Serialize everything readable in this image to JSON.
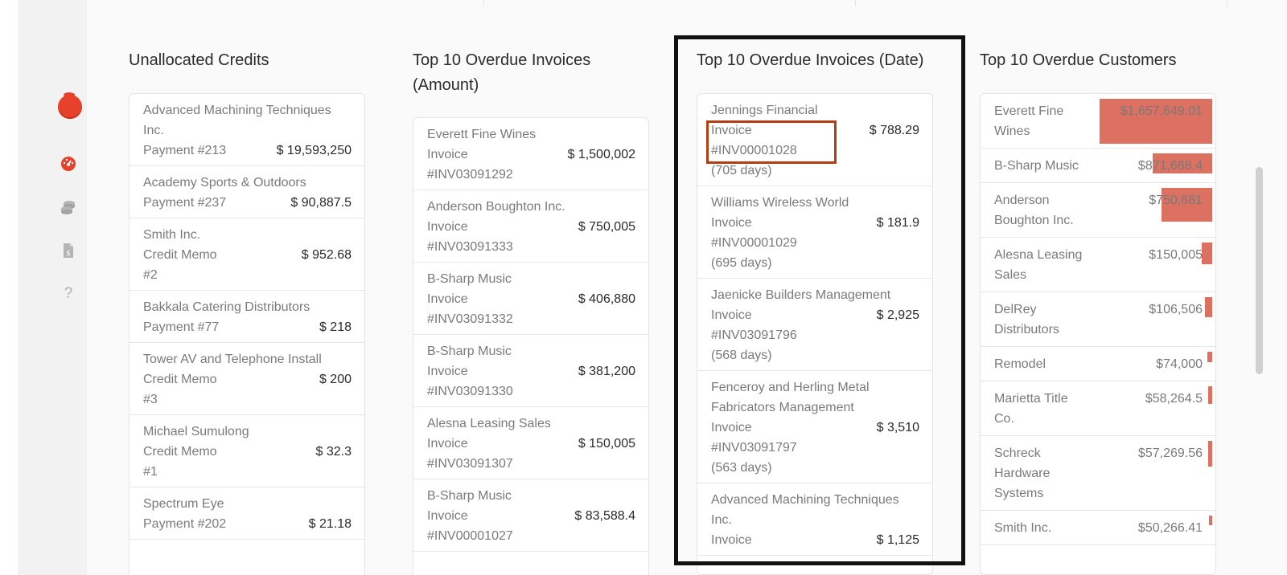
{
  "sidebar": {
    "icons": [
      "app-logo",
      "dashboard-icon",
      "coins-icon",
      "invoice-document-icon",
      "help-question-icon"
    ],
    "help_glyph": "?"
  },
  "columns": {
    "credits": {
      "title": "Unallocated Credits",
      "items": [
        {
          "name": "Advanced Machining Techniques Inc.",
          "ref": "Payment #213",
          "amount": "$ 19,593,250"
        },
        {
          "name": "Academy Sports & Outdoors",
          "ref": "Payment #237",
          "amount": "$ 90,887.5"
        },
        {
          "name": "Smith Inc.",
          "ref": "Credit Memo #2",
          "amount": "$ 952.68"
        },
        {
          "name": "Bakkala Catering Distributors",
          "ref": "Payment #77",
          "amount": "$ 218"
        },
        {
          "name": "Tower AV and Telephone Install",
          "ref": "Credit Memo #3",
          "amount": "$ 200"
        },
        {
          "name": "Michael Sumulong",
          "ref": "Credit Memo #1",
          "amount": "$ 32.3"
        },
        {
          "name": "Spectrum Eye",
          "ref": "Payment #202",
          "amount": "$ 21.18"
        }
      ]
    },
    "overdue_amount": {
      "title": "Top 10 Overdue Invoices (Amount)",
      "items": [
        {
          "name": "Everett Fine Wines",
          "ref": "Invoice #INV03091292",
          "amount": "$ 1,500,002"
        },
        {
          "name": "Anderson Boughton Inc.",
          "ref": "Invoice #INV03091333",
          "amount": "$ 750,005"
        },
        {
          "name": "B-Sharp Music",
          "ref": "Invoice #INV03091332",
          "amount": "$ 406,880"
        },
        {
          "name": "B-Sharp Music",
          "ref": "Invoice #INV03091330",
          "amount": "$ 381,200"
        },
        {
          "name": "Alesna Leasing Sales",
          "ref": "Invoice #INV03091307",
          "amount": "$ 150,005"
        },
        {
          "name": "B-Sharp Music",
          "ref": "Invoice #INV00001027",
          "amount": "$ 83,588.4"
        }
      ]
    },
    "overdue_date": {
      "title": "Top 10 Overdue Invoices (Date)",
      "items": [
        {
          "name": "Jennings Financial",
          "ref": "Invoice #INV00001028",
          "days": "(705 days)",
          "amount": "$ 788.29"
        },
        {
          "name": "Williams Wireless World",
          "ref": "Invoice #INV00001029",
          "days": "(695 days)",
          "amount": "$ 181.9"
        },
        {
          "name": "Jaenicke Builders Management",
          "ref": "Invoice #INV03091796",
          "days": "(568 days)",
          "amount": "$ 2,925"
        },
        {
          "name": "Fenceroy and Herling Metal Fabricators Management",
          "ref": "Invoice #INV03091797",
          "days": "(563 days)",
          "amount": "$ 3,510"
        },
        {
          "name": "Advanced Machining Techniques Inc.",
          "ref": "Invoice",
          "days": "",
          "amount": "$ 1,125"
        }
      ]
    },
    "customers": {
      "title": "Top 10 Overdue Customers",
      "bar_color": "#dc7061",
      "items": [
        {
          "name": "Everett Fine Wines",
          "amount": "$1,657,649.01",
          "value": 1657649.01
        },
        {
          "name": "B-Sharp Music",
          "amount": "$871,668.4",
          "value": 871668.4
        },
        {
          "name": "Anderson Boughton Inc.",
          "amount": "$750,681",
          "value": 750681
        },
        {
          "name": "Alesna Leasing Sales",
          "amount": "$150,005",
          "value": 150005
        },
        {
          "name": "DelRey Distributors",
          "amount": "$106,506",
          "value": 106506
        },
        {
          "name": "Remodel",
          "amount": "$74,000",
          "value": 74000
        },
        {
          "name": "Marietta Title Co.",
          "amount": "$58,264.5",
          "value": 58264.5
        },
        {
          "name": "Schreck Hardware Systems",
          "amount": "$57,269.56",
          "value": 57269.56
        },
        {
          "name": "Smith Inc.",
          "amount": "$50,266.41",
          "value": 50266.41
        }
      ]
    }
  }
}
